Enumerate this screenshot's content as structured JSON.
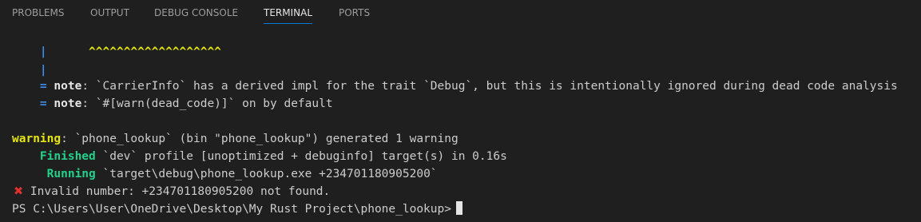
{
  "tabs": [
    {
      "label": "PROBLEMS"
    },
    {
      "label": "OUTPUT"
    },
    {
      "label": "DEBUG CONSOLE"
    },
    {
      "label": "TERMINAL",
      "active": true
    },
    {
      "label": "PORTS"
    }
  ],
  "terminal": {
    "caret_line": {
      "pipe": "|",
      "carets": "^^^^^^^^^^^^^^^^^^^"
    },
    "pipe_line": {
      "pipe": "|"
    },
    "note1": {
      "prefix": "=",
      "keyword": "note",
      "text": ": `CarrierInfo` has a derived impl for the trait `Debug`, but this is intentionally ignored during dead code analysis"
    },
    "note2": {
      "prefix": "=",
      "keyword": "note",
      "text": ": `#[warn(dead_code)]` on by default"
    },
    "warning": {
      "keyword": "warning",
      "text": ": `phone_lookup` (bin \"phone_lookup\") generated 1 warning"
    },
    "finished": {
      "keyword": "Finished",
      "text": " `dev` profile [unoptimized + debuginfo] target(s) in 0.16s"
    },
    "running": {
      "keyword": "Running",
      "text": " `target\\debug\\phone_lookup.exe +234701180905200`"
    },
    "error": {
      "icon": "cross-mark-icon",
      "symbol": "✖",
      "text": " Invalid number: +234701180905200 not found."
    },
    "prompt": {
      "text": "PS C:\\Users\\User\\OneDrive\\Desktop\\My Rust Project\\phone_lookup>"
    }
  },
  "colors": {
    "background": "#1f1f1f",
    "accent": "#0078d4",
    "note_blue": "#3b8eea",
    "warning_yellow": "#e5e510",
    "cargo_green": "#23d18b",
    "error_red": "#e03030"
  }
}
